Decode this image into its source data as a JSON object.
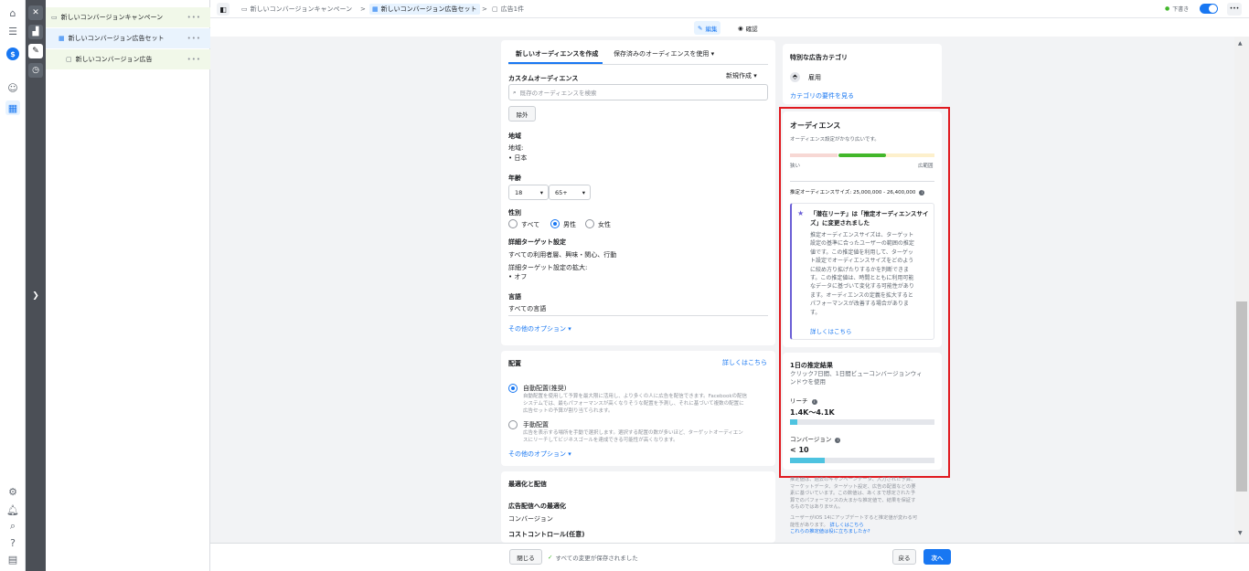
{
  "tree": {
    "campaign": "新しいコンバージョンキャンペーン",
    "adset": "新しいコンバージョン広告セット",
    "ad": "新しいコンバージョン広告",
    "more": "•••"
  },
  "breadcrumb": {
    "campaign": "新しいコンバージョンキャンペーン",
    "adset": "新しいコンバージョン広告セット",
    "ad": "広告1件",
    "sep": ">"
  },
  "topright": {
    "draft": "下書き",
    "more": "•••"
  },
  "modes": {
    "edit": "編集",
    "review": "確認"
  },
  "audience": {
    "tab_new": "新しいオーディエンスを作成",
    "tab_saved": "保存済みのオーディエンスを使用 ▾",
    "custom_title": "カスタムオーディエンス",
    "create_new": "新規作成 ▾",
    "search_placeholder": "既存のオーディエンスを検索",
    "exclude": "除外",
    "location_title": "地域",
    "location_sub": "地域:",
    "location_value": "• 日本",
    "age_title": "年齢",
    "age_min": "18",
    "age_max": "65+",
    "gender_title": "性別",
    "gender_all": "すべて",
    "gender_male": "男性",
    "gender_female": "女性",
    "detail_title": "詳細ターゲット設定",
    "detail_value": "すべての利用者層、興味・関心、行動",
    "expand_title": "詳細ターゲット設定の拡大:",
    "expand_value": "• オフ",
    "lang_title": "言語",
    "lang_value": "すべての言語",
    "more_options": "その他のオプション ▾"
  },
  "placement": {
    "title": "配置",
    "learn_more": "詳しくはこちら",
    "auto_title": "自動配置(推奨)",
    "auto_desc1": "自動配置を使用して予算を最大限に活用し、より多くの人に広告を配信できます。Facebookの配信",
    "auto_desc2": "システムでは、最もパフォーマンスが高くなりそうな配置を予測し、それに基づいて複数の配置に",
    "auto_desc3": "広告セットの予算が割り当てられます。",
    "manual_title": "手動配置",
    "manual_desc1": "広告を表示する場所を手動で選択します。選択する配置の数が多いほど、ターゲットオーディエン",
    "manual_desc2": "スにリーチしてビジネスゴールを達成できる可能性が高くなります。",
    "more_options": "その他のオプション ▾"
  },
  "optimization": {
    "title": "最適化と配信",
    "sub1": "広告配信への最適化",
    "val1": "コンバージョン",
    "sub2": "コストコントロール(任意)"
  },
  "special": {
    "title": "特別な広告カテゴリ",
    "item": "雇用",
    "link": "カテゴリの要件を見る"
  },
  "audience_def": {
    "title": "オーディエンス",
    "subtitle": "オーディエンス設定がかなり広いです。",
    "narrow": "狭い",
    "broad": "広範囲",
    "size": "推定オーディエンスサイズ: 25,000,000 - 26,400,000",
    "notice_title1": "「潜在リーチ」は「推定オーディエンスサイ",
    "notice_title2": "ズ」に変更されました",
    "notice_body": [
      "推定オーディエンスサイズは、ターゲット",
      "設定の基準に合ったユーザーの範囲の推定",
      "値です。この推定値を利用して、ターゲッ",
      "ト設定でオーディエンスサイズをどのよう",
      "に絞め方り拡げたりするかを判断できま",
      "す。この推定値は、時間とともに利用可能",
      "なデータに基づいて変化する可能性があり",
      "ます。オーディエンスの定義を拡大すると",
      "パフォーマンスが改善する場合がありま",
      "す。"
    ],
    "notice_link": "詳しくはこちら",
    "meter_fraction": 0.5
  },
  "daily": {
    "title": "1日の推定結果",
    "subtitle1": "クリック7日間、1日間ビューコンバージョンウィ",
    "subtitle2": "ンドウを使用",
    "reach_label": "リーチ",
    "reach_value": "1.4K〜4.1K",
    "reach_fraction": 0.05,
    "conv_label": "コンバージョン",
    "conv_value": "< 10",
    "conv_fraction": 0.24
  },
  "footnote": {
    "lines": [
      "推定値は、過去のキャンペーンデータ、入力された予算、",
      "マーケットデータ、ターゲット設定、広告の配置などの要",
      "素に基づいています。この数値は、あくまで想定された予",
      "算でのパフォーマンスの大まかな推定値で、結果を保証す",
      "るものではありません。"
    ],
    "ios1": "ユーザーがiOS 14にアップデートすると推定値が変わる可",
    "ios2": "能性があります。",
    "ios_link": "詳しくはこちら",
    "helpful": "これらの推定値は役に立ちましたか?"
  },
  "bottom": {
    "close": "閉じる",
    "saved": "すべての変更が保存されました",
    "back": "戻る",
    "next": "次へ"
  },
  "colors": {
    "accent": "#1877f2",
    "highlight": "#e0191f",
    "meter_good": "#42b72a",
    "bar_fill": "#4ec3e0"
  }
}
